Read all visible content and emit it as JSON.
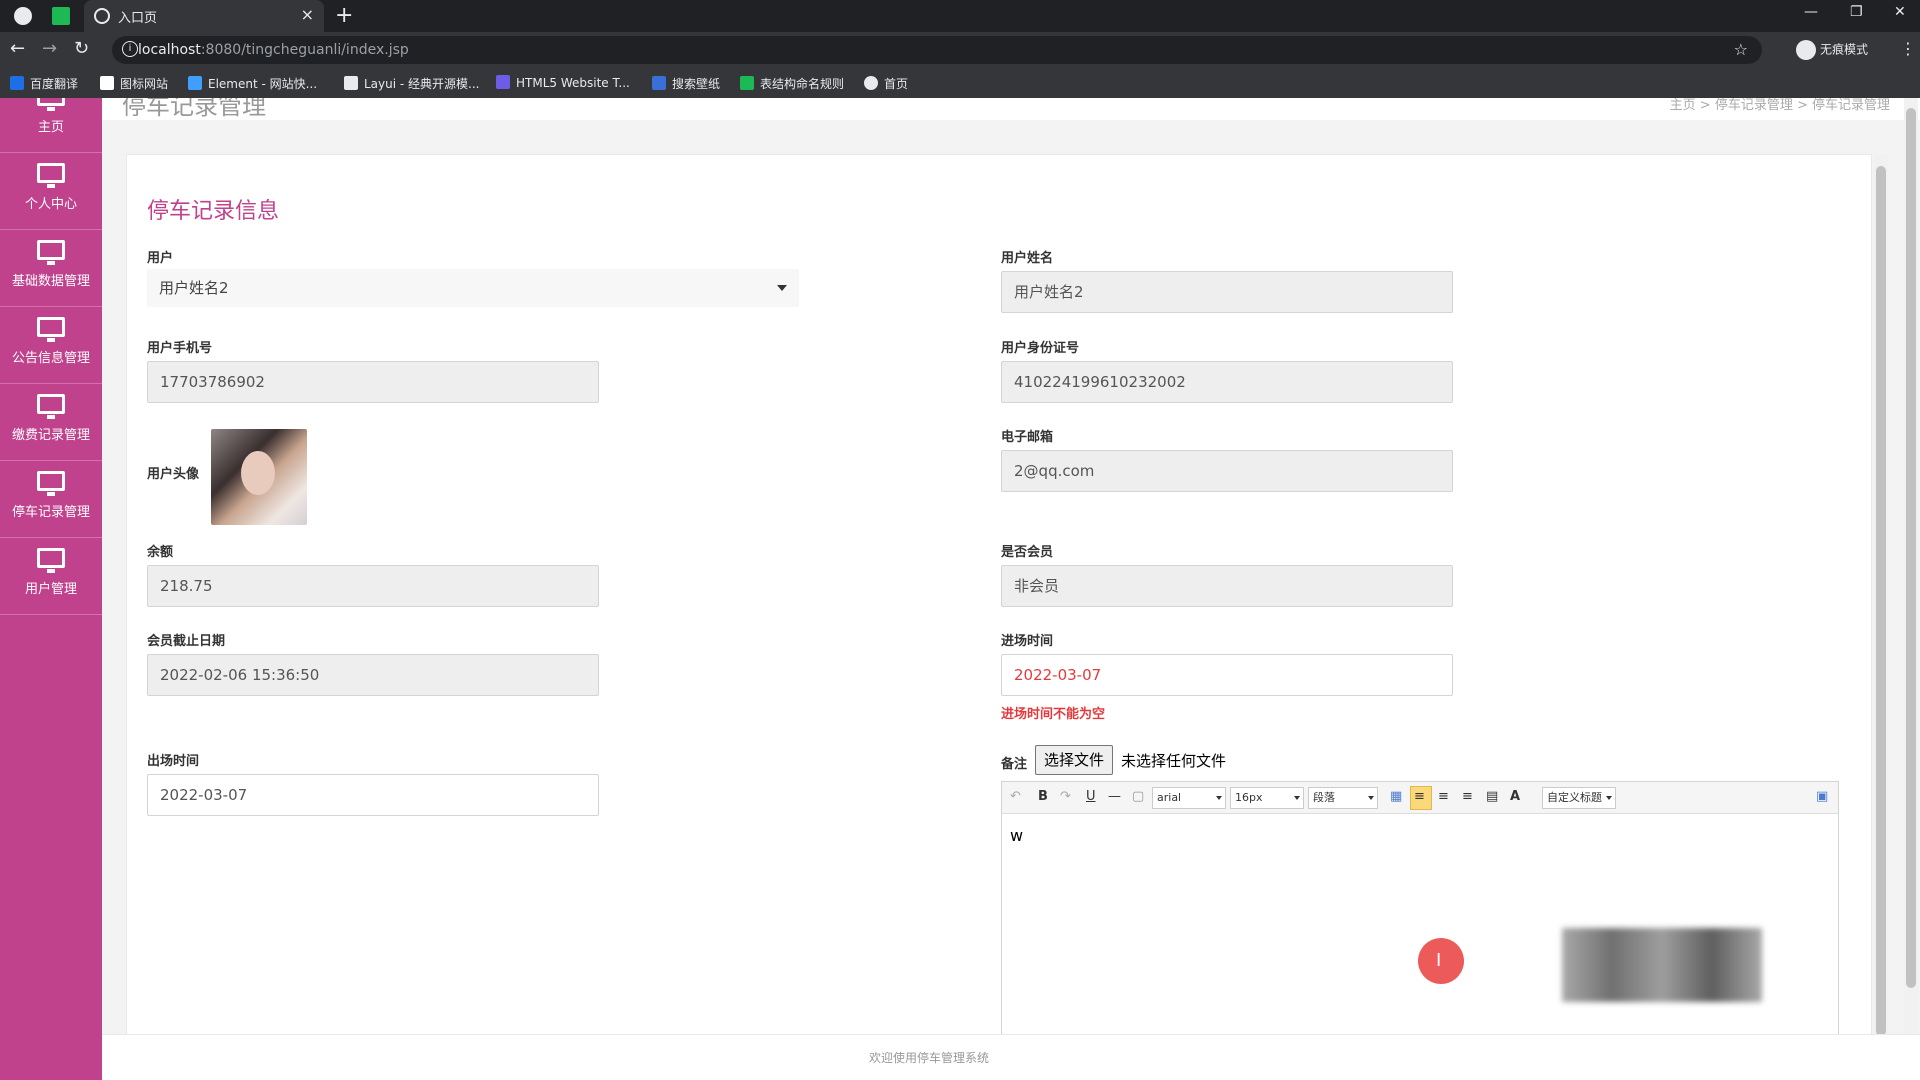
{
  "browser": {
    "tab_title": "入口页",
    "url_host": "localhost",
    "url_rest": ":8080/tingcheguanli/index.jsp",
    "incognito_label": "无痕模式",
    "bookmarks": [
      {
        "label": "百度翻译",
        "color": "#1e6fe6"
      },
      {
        "label": "图标网站",
        "color": "#ffffff"
      },
      {
        "label": "Element - 网站快...",
        "color": "#409eff"
      },
      {
        "label": "Layui - 经典开源模...",
        "color": "#e8eaed"
      },
      {
        "label": "HTML5 Website T...",
        "color": "#6c5ce7"
      },
      {
        "label": "搜索壁纸",
        "color": "#3b6fd8"
      },
      {
        "label": "表结构命名规则",
        "color": "#1db954"
      },
      {
        "label": "首页",
        "color": "#e8eaed"
      }
    ]
  },
  "sidebar": {
    "items": [
      {
        "label": "主页"
      },
      {
        "label": "个人中心"
      },
      {
        "label": "基础数据管理"
      },
      {
        "label": "公告信息管理"
      },
      {
        "label": "缴费记录管理"
      },
      {
        "label": "停车记录管理"
      },
      {
        "label": "用户管理"
      }
    ]
  },
  "header": {
    "page_title": "停车记录管理",
    "breadcrumb": "主页 > 停车记录管理 > 停车记录管理"
  },
  "form": {
    "title": "停车记录信息",
    "user_label": "用户",
    "user_value": "用户姓名2",
    "username_label": "用户姓名",
    "username_value": "用户姓名2",
    "phone_label": "用户手机号",
    "phone_value": "17703786902",
    "idcard_label": "用户身份证号",
    "idcard_value": "410224199610232002",
    "avatar_label": "用户头像",
    "email_label": "电子邮箱",
    "email_value": "2@qq.com",
    "balance_label": "余额",
    "balance_value": "218.75",
    "member_label": "是否会员",
    "member_value": "非会员",
    "member_expire_label": "会员截止日期",
    "member_expire_value": "2022-02-06 15:36:50",
    "entry_label": "进场时间",
    "entry_value": "2022-03-07",
    "entry_error": "进场时间不能为空",
    "exit_label": "出场时间",
    "exit_value": "2022-03-07",
    "remark_label": "备注",
    "file_button": "选择文件",
    "file_none": "未选择任何文件",
    "editor": {
      "font": "arial",
      "size": "16px",
      "paragraph": "段落",
      "custom_title": "自定义标题",
      "content": "w"
    }
  },
  "footer": {
    "text": "欢迎使用停车管理系统"
  },
  "colors": {
    "sidebar": "#c0428d",
    "title": "#c0428d",
    "error": "#e4393c"
  }
}
